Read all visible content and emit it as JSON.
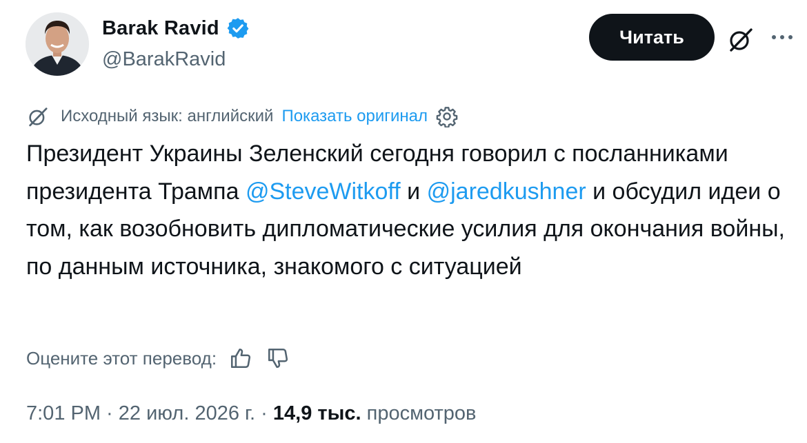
{
  "author": {
    "display_name": "Barak Ravid",
    "handle": "@BarakRavid",
    "verified": true,
    "verified_color": "#1d9bf0"
  },
  "header_actions": {
    "read_button_label": "Читать",
    "icons": [
      "grok-icon",
      "more-icon"
    ]
  },
  "translation": {
    "source_language": "Исходный язык: английский",
    "show_original_label": "Показать оригинал"
  },
  "tweet": {
    "text_part1": "Президент Украины Зеленский сегодня говорил с посланниками президента Трампа ",
    "mention1": "@SteveWitkoff",
    "text_part2": " и ",
    "mention2": "@jaredkushner",
    "text_part3": " и обсудил идеи о том, как возобновить дипломатические усилия для окончания войны, по данным источника, знакомого с ситуацией"
  },
  "rate_translation": {
    "label": "Оцените этот перевод:"
  },
  "meta": {
    "time": "7:01 PM",
    "separator": " · ",
    "date": "22 июл. 2026 г.",
    "views_count": "14,9 тыс.",
    "views_label": "просмотров"
  },
  "colors": {
    "text_primary": "#0f1419",
    "text_secondary": "#536471",
    "link": "#1d9bf0",
    "button_bg": "#0f1419"
  }
}
